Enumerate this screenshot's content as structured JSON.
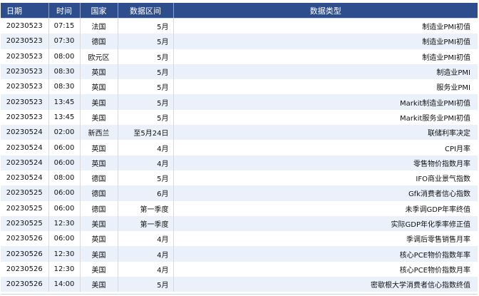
{
  "table": {
    "headers": [
      "日期",
      "时间",
      "国家",
      "数据区间",
      "数据类型"
    ],
    "rows": [
      {
        "date": "20230523",
        "time": "07:15",
        "country": "法国",
        "range": "5月",
        "type": "制造业PMI初值"
      },
      {
        "date": "20230523",
        "time": "07:30",
        "country": "德国",
        "range": "5月",
        "type": "制造业PMI初值"
      },
      {
        "date": "20230523",
        "time": "08:00",
        "country": "欧元区",
        "range": "5月",
        "type": "制造业PMI初值"
      },
      {
        "date": "20230523",
        "time": "08:30",
        "country": "英国",
        "range": "5月",
        "type": "制造业PMI"
      },
      {
        "date": "20230523",
        "time": "08:30",
        "country": "英国",
        "range": "5月",
        "type": "服务业PMI"
      },
      {
        "date": "20230523",
        "time": "13:45",
        "country": "美国",
        "range": "5月",
        "type": "Markit制造业PMI初值"
      },
      {
        "date": "20230523",
        "time": "13:45",
        "country": "美国",
        "range": "5月",
        "type": "Markit服务业PMI初值"
      },
      {
        "date": "20230524",
        "time": "02:00",
        "country": "新西兰",
        "range": "至5月24日",
        "type": "联储利率决定"
      },
      {
        "date": "20230524",
        "time": "06:00",
        "country": "英国",
        "range": "4月",
        "type": "CPI月率"
      },
      {
        "date": "20230524",
        "time": "06:00",
        "country": "英国",
        "range": "4月",
        "type": "零售物价指数月率"
      },
      {
        "date": "20230524",
        "time": "08:00",
        "country": "德国",
        "range": "5月",
        "type": "IFO商业景气指数"
      },
      {
        "date": "20230525",
        "time": "06:00",
        "country": "德国",
        "range": "6月",
        "type": "Gfk消费者信心指数"
      },
      {
        "date": "20230525",
        "time": "06:00",
        "country": "德国",
        "range": "第一季度",
        "type": "未季调GDP年率终值"
      },
      {
        "date": "20230525",
        "time": "12:30",
        "country": "美国",
        "range": "第一季度",
        "type": "实际GDP年化季率修正值"
      },
      {
        "date": "20230526",
        "time": "06:00",
        "country": "英国",
        "range": "4月",
        "type": "季调后零售销售月率"
      },
      {
        "date": "20230526",
        "time": "12:30",
        "country": "美国",
        "range": "4月",
        "type": "核心PCE物价指数年率"
      },
      {
        "date": "20230526",
        "time": "12:30",
        "country": "美国",
        "range": "4月",
        "type": "核心PCE物价指数月率"
      },
      {
        "date": "20230526",
        "time": "14:00",
        "country": "美国",
        "range": "5月",
        "type": "密歇根大学消费者信心指数终值"
      }
    ]
  }
}
